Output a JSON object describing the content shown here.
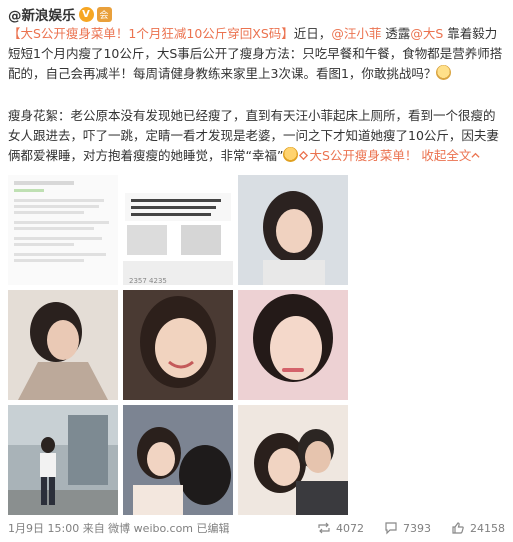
{
  "author": {
    "name": "@新浪娱乐",
    "verified_badge": "V",
    "medal_badge": "会"
  },
  "post": {
    "para1": {
      "link_title": "【大S公开瘦身菜单！1个月狂减10公斤穿回XS码】",
      "t1": "近日，",
      "mention1": "@汪小菲",
      "t2": " 透露",
      "mention2": "@大S",
      "t3": " 靠着毅力短短1个月内瘦了10公斤，大S事后公开了瘦身方法：只吃早餐和午餐，食物都是营养师搭配的，自己会再减半！每周请健身教练来家里上3次课。看图1，你敢挑战吗？"
    },
    "para2": {
      "t1": "瘦身花絮：老公原本没有发现她已经瘦了，直到有天汪小菲起床上厕所，看到一个很瘦的女人跟进去，吓了一跳，定睛一看才发现是老婆，一问之下才知道她瘦了10公斤，因夫妻俩都爱裸睡，对方抱着瘦瘦的她睡觉，非常“幸福”",
      "link_tail": "大S公开瘦身菜单！",
      "expand_label": "收起全文",
      "expand_icon": "chevron-up"
    }
  },
  "images": [
    {
      "caption": "2357   4235"
    },
    {
      "caption": "one 7 Plus"
    },
    {
      "caption": ""
    },
    {
      "caption": ""
    },
    {
      "caption": ""
    },
    {
      "caption": ""
    },
    {
      "caption": ""
    },
    {
      "caption": ""
    },
    {
      "caption": ""
    }
  ],
  "footer": {
    "meta": "1月9日 15:00 来自 微博 weibo.com 已编辑",
    "reposts": "4072",
    "comments": "7393",
    "likes": "24158"
  },
  "colors": {
    "link": "#eb7350",
    "text": "#333333",
    "meta": "#808080",
    "badge_v": "#f6a623"
  }
}
